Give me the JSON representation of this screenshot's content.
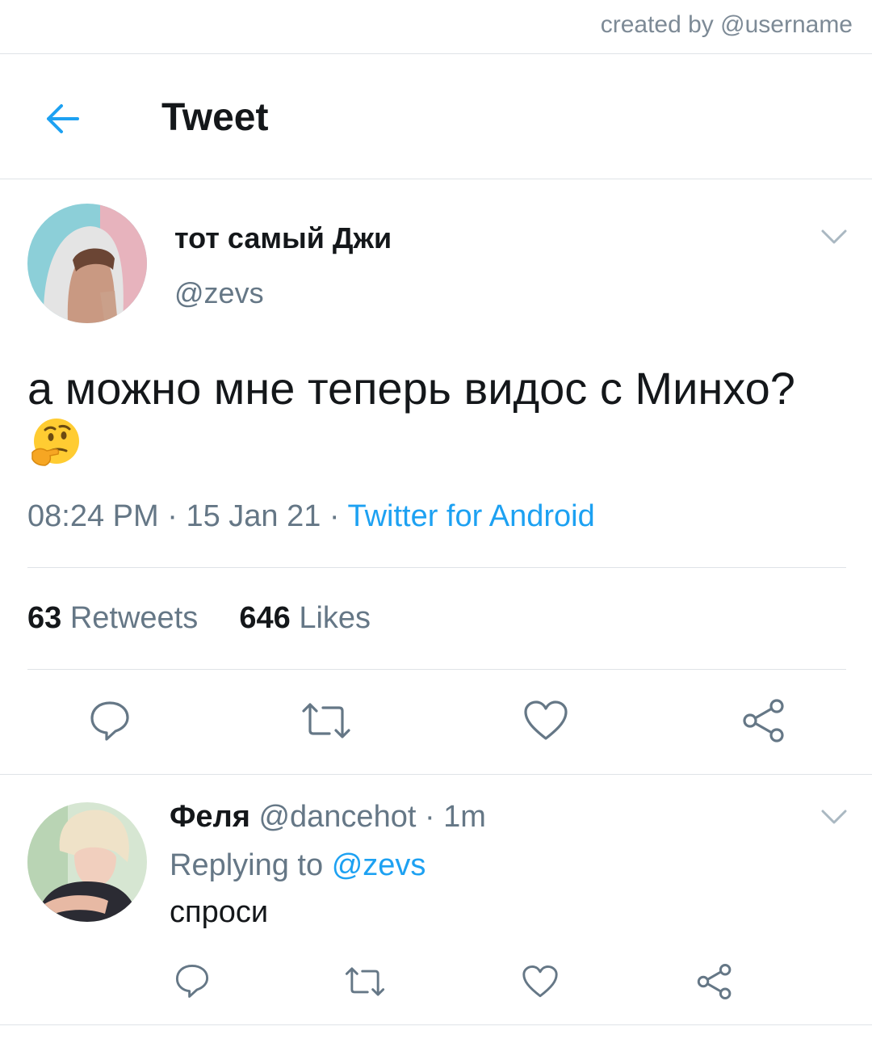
{
  "watermark": "created by @username",
  "header": {
    "title": "Tweet"
  },
  "tweet": {
    "author_name": "тот самый Джи",
    "author_handle": "@zevs",
    "text": "а можно мне теперь видос с Минхо?",
    "emoji": "thinking-face",
    "time": "08:24 PM",
    "date": "15 Jan 21",
    "source": "Twitter for Android",
    "retweets_count": "63",
    "retweets_label": "Retweets",
    "likes_count": "646",
    "likes_label": "Likes"
  },
  "reply": {
    "author_name": "Феля",
    "author_handle": "@dancehot",
    "time": "1m",
    "replying_to_label": "Replying to",
    "replying_to_handle": "@zevs",
    "text": "спроси"
  },
  "colors": {
    "accent": "#1da1f2",
    "muted": "#657786",
    "divider": "#dfe3e7",
    "text": "#14171a"
  },
  "icons": [
    "back-arrow-icon",
    "chevron-down-icon",
    "reply-icon",
    "retweet-icon",
    "like-icon",
    "share-icon"
  ]
}
